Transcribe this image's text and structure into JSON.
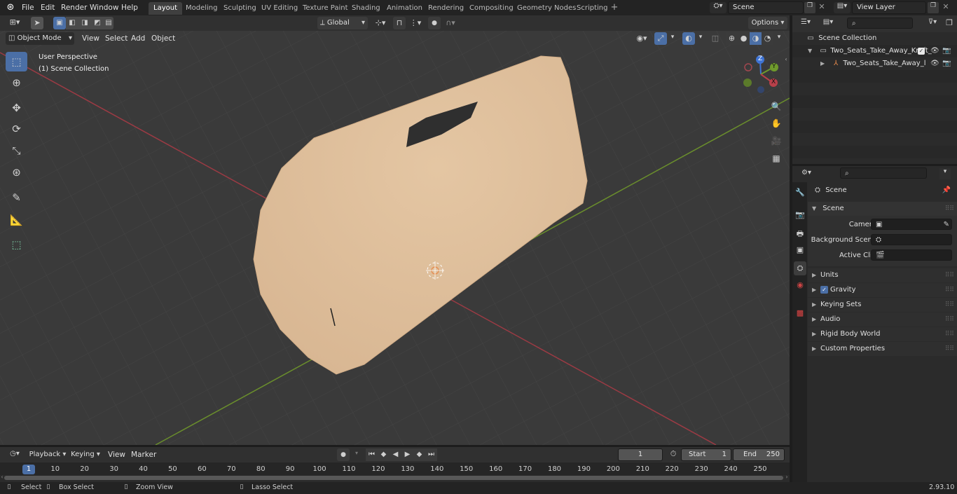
{
  "menus": [
    "File",
    "Edit",
    "Render",
    "Window",
    "Help"
  ],
  "workspaces": [
    "Layout",
    "Modeling",
    "Sculpting",
    "UV Editing",
    "Texture Paint",
    "Shading",
    "Animation",
    "Rendering",
    "Compositing",
    "Geometry Nodes",
    "Scripting"
  ],
  "active_workspace": "Layout",
  "scene_field": "Scene",
  "view_layer_field": "View Layer",
  "header": {
    "transform_orientation": "Global",
    "options_label": "Options",
    "mode": "Object Mode",
    "view_menus": [
      "View",
      "Select",
      "Add",
      "Object"
    ]
  },
  "viewport": {
    "perspective_label": "User Perspective",
    "collection_label": "(1) Scene Collection",
    "gizmo_axes": [
      "Z",
      "Y",
      "X"
    ]
  },
  "outliner": {
    "root": "Scene Collection",
    "items": [
      "Two_Seats_Take_Away_Kraft_",
      "Two_Seats_Take_Away_l"
    ]
  },
  "properties": {
    "context_title": "Scene",
    "section": "Scene",
    "fields": [
      {
        "label": "Camera",
        "value": ""
      },
      {
        "label": "Background Scene",
        "value": ""
      },
      {
        "label": "Active Clip",
        "value": ""
      }
    ],
    "subpanels": [
      "Units",
      "Gravity",
      "Keying Sets",
      "Audio",
      "Rigid Body World",
      "Custom Properties"
    ],
    "gravity_checked": true
  },
  "timeline": {
    "menus": [
      "Playback",
      "Keying",
      "View",
      "Marker"
    ],
    "current_frame": "1",
    "start_label": "Start",
    "start_value": "1",
    "end_label": "End",
    "end_value": "250",
    "ticks": [
      "1",
      "10",
      "20",
      "30",
      "40",
      "50",
      "60",
      "70",
      "80",
      "90",
      "100",
      "110",
      "120",
      "130",
      "140",
      "150",
      "160",
      "170",
      "180",
      "190",
      "200",
      "210",
      "220",
      "230",
      "240",
      "250"
    ]
  },
  "statusbar": {
    "items": [
      "Select",
      "Box Select",
      "Zoom View",
      "Lasso Select"
    ],
    "version": "2.93.10"
  },
  "colors": {
    "active_blue": "#4b6fa6",
    "object_color": "#dfbf9b",
    "x_axis": "#b8404a",
    "y_axis": "#6f9a2c",
    "z_axis": "#3f74d4"
  }
}
